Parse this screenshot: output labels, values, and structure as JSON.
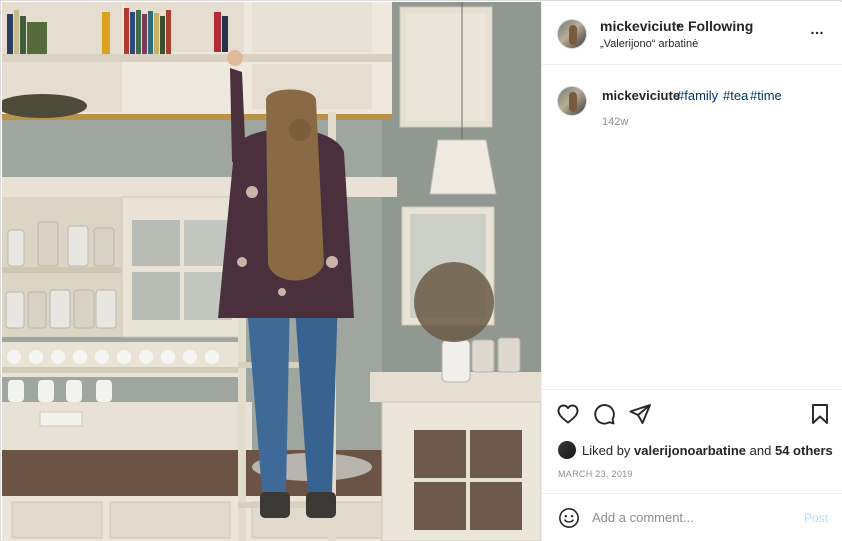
{
  "post": {
    "username": "mickeviciute",
    "separator": "•",
    "follow_status": "Following",
    "location": "„Valerijono“ arbatinė",
    "caption": {
      "username": "mickeviciute",
      "hashtags": [
        "#family",
        "#tea",
        "#time"
      ],
      "age": "142w"
    },
    "likes": {
      "prefix": "Liked by",
      "first_liker": "valerijonoarbatine",
      "and": "and",
      "others": "54 others"
    },
    "date": "MARCH 23, 2019"
  },
  "comment": {
    "placeholder": "Add a comment...",
    "post_label": "Post"
  },
  "icons": {
    "more": "more-options-icon",
    "like": "heart-icon",
    "comment": "comment-icon",
    "share": "share-icon",
    "save": "bookmark-icon",
    "emoji": "emoji-icon"
  },
  "colors": {
    "hashtag": "#00376b",
    "post_disabled": "#b2dffc",
    "muted": "#8e8e8e"
  }
}
